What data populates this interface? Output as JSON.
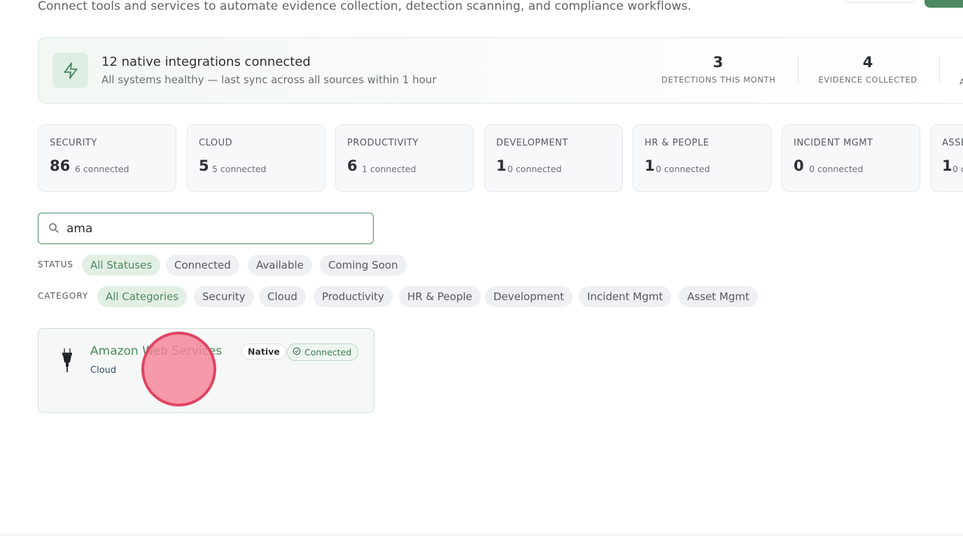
{
  "header": {
    "subtitle": "Connect tools and services to automate evidence collection, detection scanning, and compliance workflows."
  },
  "banner": {
    "title": "12 native integrations connected",
    "subtitle": "All systems healthy — last sync across all sources within 1 hour",
    "stats": [
      {
        "value": "3",
        "label": "DETECTIONS THIS MONTH"
      },
      {
        "value": "4",
        "label": "EVIDENCE COLLECTED"
      },
      {
        "value": "",
        "label": "A"
      }
    ]
  },
  "categories": [
    {
      "name": "SECURITY",
      "count": "86",
      "connected": "6 connected"
    },
    {
      "name": "CLOUD",
      "count": "5",
      "connected": "5 connected"
    },
    {
      "name": "PRODUCTIVITY",
      "count": "6",
      "connected": "1 connected"
    },
    {
      "name": "DEVELOPMENT",
      "count": "1",
      "connected": "0 connected"
    },
    {
      "name": "HR & PEOPLE",
      "count": "1",
      "connected": "0 connected"
    },
    {
      "name": "INCIDENT MGMT",
      "count": "0",
      "connected": "0 connected"
    },
    {
      "name": "ASSE",
      "count": "1",
      "connected": "0 c"
    }
  ],
  "search": {
    "value": "ama",
    "icon": "search-icon"
  },
  "filters": {
    "status_label": "STATUS",
    "status_options": [
      "All Statuses",
      "Connected",
      "Available",
      "Coming Soon"
    ],
    "status_selected": "All Statuses",
    "category_label": "CATEGORY",
    "category_options": [
      "All Categories",
      "Security",
      "Cloud",
      "Productivity",
      "HR & People",
      "Development",
      "Incident Mgmt",
      "Asset Mgmt"
    ],
    "category_selected": "All Categories"
  },
  "results": [
    {
      "name": "Amazon Web Services",
      "category": "Cloud",
      "badge_native": "Native",
      "badge_status": "Connected",
      "icon": "plug-icon"
    }
  ],
  "colors": {
    "accent": "#4a8a5e",
    "accent_light": "#e2efe5",
    "chip_bg": "#eef0f3",
    "click_indicator": "#e04563"
  }
}
